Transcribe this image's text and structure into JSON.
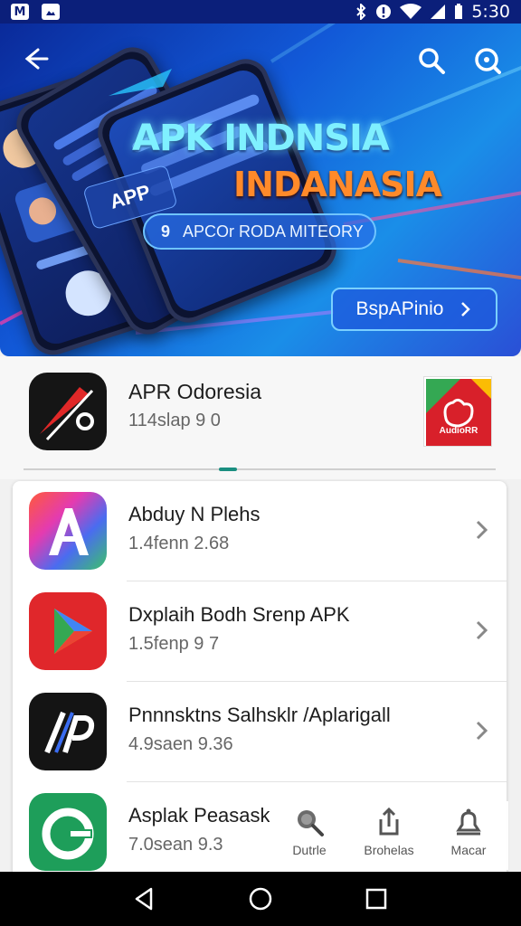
{
  "status_bar": {
    "left_icons": [
      "gmail-icon",
      "photo-icon"
    ],
    "right_icons": [
      "bluetooth-icon",
      "data-saver-icon",
      "wifi-icon",
      "signal-icon",
      "battery-icon"
    ],
    "time": "5:30"
  },
  "banner": {
    "title_line1": "APK INDNSIA",
    "title_line2": "INDANASIA",
    "app_tag": "APP",
    "pill_number": "9",
    "pill_text": "APCOr RODA MITEORY",
    "cta_label": "BspAPinio",
    "colors": {
      "title1": "#7ff0ff",
      "title2": "#ff8a2a",
      "background": "#1259d8"
    }
  },
  "featured": {
    "name": "APR Odoresia",
    "subtitle": "114slap 9 0",
    "thumb_text": "AudioRR"
  },
  "apps": [
    {
      "name": "Abduy  N Plehs",
      "subtitle": "1.4fenn 2.68",
      "icon": "letter-a-icon"
    },
    {
      "name": "Dxplaih Bodh Srenp APK",
      "subtitle": "1.5fenp 9 7",
      "icon": "play-triangle-icon"
    },
    {
      "name": "Pnnnsktns Salhsklr /Aplarigall",
      "subtitle": "4.9saen 9.36",
      "icon": "letter-p-icon"
    },
    {
      "name": "Asplak Peasask",
      "subtitle": "7.0sean 9.3",
      "icon": "green-circle-icon"
    }
  ],
  "dock": [
    {
      "label": "Dutrle",
      "icon": "search-icon"
    },
    {
      "label": "Brohelas",
      "icon": "share-icon"
    },
    {
      "label": "Macar",
      "icon": "bell-icon"
    }
  ],
  "nav": [
    "back-icon",
    "home-icon",
    "recents-icon"
  ]
}
